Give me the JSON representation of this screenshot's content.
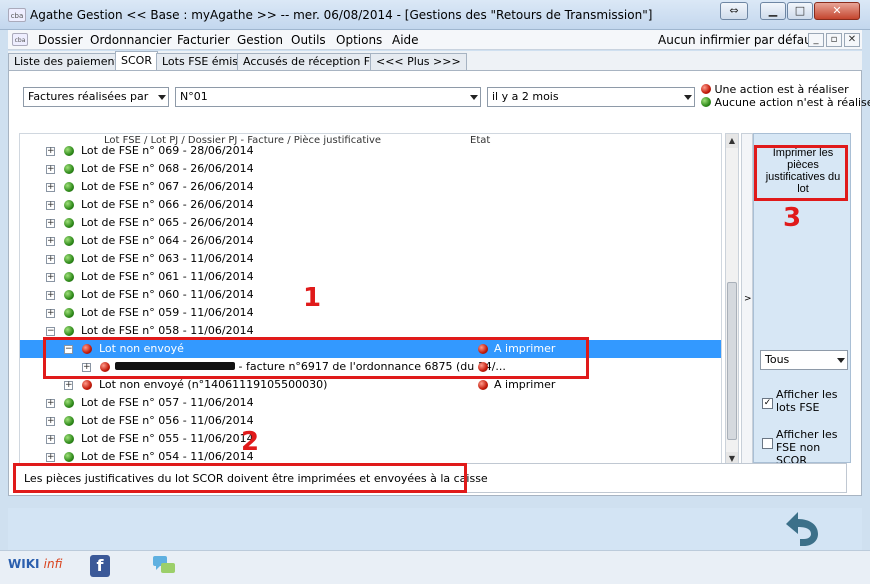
{
  "window": {
    "icon_text": "cba",
    "title": "Agathe Gestion << Base : myAgathe >>   --   mer. 06/08/2014  -  [Gestions des \"Retours de Transmission\"]"
  },
  "menu": {
    "items": [
      "Dossier",
      "Ordonnancier",
      "Facturier",
      "Gestion",
      "Outils",
      "Options",
      "Aide"
    ],
    "right_label": "Aucun infirmier par défaut"
  },
  "tabs": [
    "Liste des paiements",
    "SCOR",
    "Lots FSE émis",
    "Accusés de réception FSE",
    "<<< Plus >>>"
  ],
  "filters": {
    "type": "Factures réalisées par",
    "number": "N°01",
    "period": "il y a 2 mois"
  },
  "legend": {
    "red": "Une action est à réaliser",
    "green": "Aucune action n'est à réaliser"
  },
  "tree": {
    "col_lot": "Lot FSE / Lot PJ / Dossier PJ - Facture / Pièce justificative",
    "col_etat": "Etat",
    "rows": [
      {
        "label": "Lot de FSE n° 069 - 28/06/2014",
        "status": "green"
      },
      {
        "label": "Lot de FSE n° 068 - 26/06/2014",
        "status": "green"
      },
      {
        "label": "Lot de FSE n° 067 - 26/06/2014",
        "status": "green"
      },
      {
        "label": "Lot de FSE n° 066 - 26/06/2014",
        "status": "green"
      },
      {
        "label": "Lot de FSE n° 065 - 26/06/2014",
        "status": "green"
      },
      {
        "label": "Lot de FSE n° 064 - 26/06/2014",
        "status": "green"
      },
      {
        "label": "Lot de FSE n° 063 - 11/06/2014",
        "status": "green"
      },
      {
        "label": "Lot de FSE n° 061 - 11/06/2014",
        "status": "green"
      },
      {
        "label": "Lot de FSE n° 060 - 11/06/2014",
        "status": "green"
      },
      {
        "label": "Lot de FSE n° 059 - 11/06/2014",
        "status": "green"
      },
      {
        "label": "Lot de FSE n° 058 - 11/06/2014",
        "status": "green"
      },
      {
        "label": "Lot non envoyé",
        "status": "red",
        "etat": "A imprimer"
      },
      {
        "label": " - facture n°6917 de l'ordonnance 6875 (du 14/...",
        "status": "red",
        "etat": ""
      },
      {
        "label": "Lot non envoyé  (n°14061119105500030)",
        "status": "red",
        "etat": "A imprimer"
      },
      {
        "label": "Lot de FSE n° 057 - 11/06/2014",
        "status": "green"
      },
      {
        "label": "Lot de FSE n° 056 - 11/06/2014",
        "status": "green"
      },
      {
        "label": "Lot de FSE n° 055 - 11/06/2014",
        "status": "green"
      },
      {
        "label": "Lot de FSE n° 054 - 11/06/2014",
        "status": "green"
      }
    ]
  },
  "side_panel": {
    "toggle": ">",
    "print_button": "Imprimer les pièces justificatives du lot",
    "filter_value": "Tous",
    "chk_lots": "Afficher les lots FSE",
    "chk_fse": "Afficher les FSE non SCOR"
  },
  "status_message": "Les pièces justificatives du lot SCOR doivent être imprimées et envoyées à la caisse",
  "annotations": [
    "1",
    "2",
    "3"
  ],
  "footer": {
    "wiki_a": "WIKI",
    "wiki_b": "infi",
    "facebook": "f"
  },
  "colors": {
    "selection": "#3399ff",
    "annotation": "#e01a1a",
    "status_red": "#c21a0a",
    "status_green": "#2f8a1a"
  }
}
